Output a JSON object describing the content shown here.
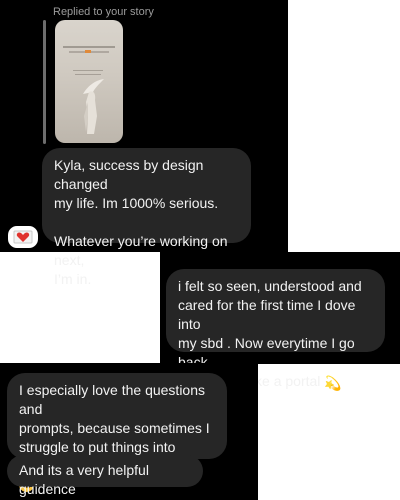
{
  "reply": {
    "label": "Replied to your story"
  },
  "messages": {
    "m1_line1": "Kyla, success by design changed",
    "m1_line2": "my life. Im 1000% serious.",
    "m1_line3": "Whatever you’re working on next,",
    "m1_line4": "I’m in.",
    "m2_line1": "i felt so seen, understood and",
    "m2_line2": "cared for the first time I dove into",
    "m2_line3": "my sbd . Now everytime I go back",
    "m2_line4": "to it it feels like a portal",
    "m3_line1": "I especially love the questions and",
    "m3_line2": "prompts, because sometimes I",
    "m3_line3": "struggle to put things into practice",
    "m4_line1": "And its a very helpful guidence"
  },
  "icons": {
    "reaction": "heart-envelope-icon",
    "portal_emoji": "dizzy-icon",
    "practice_emoji": "smiling-face-icon"
  },
  "colors": {
    "background": "#000000",
    "bubble": "#262626",
    "text": "#f2f2f2",
    "muted": "#9b9b9b"
  }
}
